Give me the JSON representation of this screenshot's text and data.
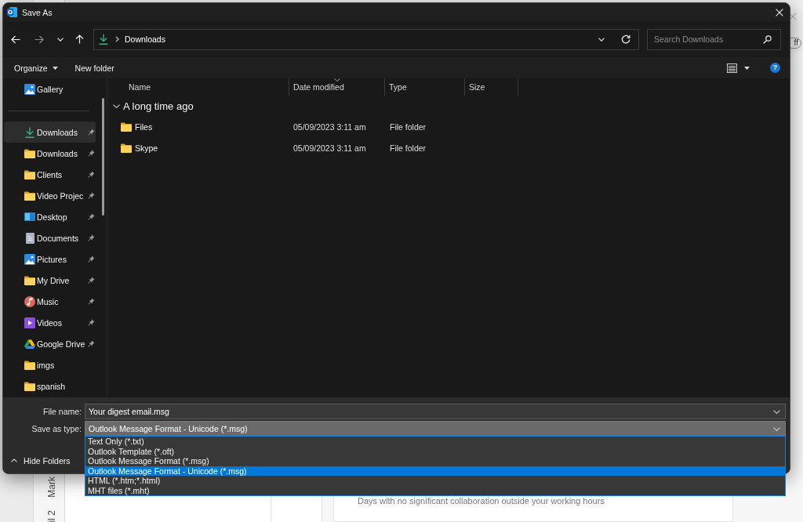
{
  "window": {
    "title": "Save As"
  },
  "navigation": {
    "buttons": [
      {
        "kind": "back",
        "disabled": false
      },
      {
        "kind": "forward",
        "disabled": true
      },
      {
        "kind": "recent",
        "disabled": false
      },
      {
        "kind": "up",
        "disabled": false
      }
    ],
    "address": {
      "path": [
        "Downloads"
      ]
    },
    "search": {
      "placeholder": "Search Downloads"
    }
  },
  "toolbar": {
    "organize": "Organize",
    "new_folder": "New folder",
    "help": "?"
  },
  "sidebar": {
    "sections": [
      {
        "items": [
          {
            "label": "Gallery",
            "kind": "gallery",
            "pinned": false,
            "selected": false
          }
        ]
      },
      {
        "items": [
          {
            "label": "Downloads",
            "kind": "downloads",
            "pinned": true,
            "selected": true
          },
          {
            "label": "Downloads",
            "kind": "folder",
            "pinned": true,
            "selected": false
          },
          {
            "label": "Clients",
            "kind": "folder",
            "pinned": true,
            "selected": false
          },
          {
            "label": "Video Projec",
            "kind": "folder",
            "pinned": true,
            "selected": false
          },
          {
            "label": "Desktop",
            "kind": "desktop",
            "pinned": true,
            "selected": false
          },
          {
            "label": "Documents",
            "kind": "documents",
            "pinned": true,
            "selected": false
          },
          {
            "label": "Pictures",
            "kind": "pictures",
            "pinned": true,
            "selected": false
          },
          {
            "label": "My Drive",
            "kind": "folder",
            "pinned": true,
            "selected": false
          },
          {
            "label": "Music",
            "kind": "music",
            "pinned": true,
            "selected": false
          },
          {
            "label": "Videos",
            "kind": "videos",
            "pinned": true,
            "selected": false
          },
          {
            "label": "Google Drive",
            "kind": "drive",
            "pinned": true,
            "selected": false
          },
          {
            "label": "imgs",
            "kind": "folder",
            "pinned": false,
            "selected": false
          },
          {
            "label": "spanish",
            "kind": "folder",
            "pinned": false,
            "selected": false
          }
        ]
      }
    ]
  },
  "file_list": {
    "columns": [
      {
        "label": "Name",
        "sorted": false
      },
      {
        "label": "Date modified",
        "sorted": true
      },
      {
        "label": "Type",
        "sorted": false
      },
      {
        "label": "Size",
        "sorted": false
      }
    ],
    "groups": [
      {
        "label": "A long time ago",
        "expanded": true,
        "rows": [
          {
            "name": "Files",
            "date_modified": "05/09/2023 3:11 am",
            "type": "File folder"
          },
          {
            "name": "Skype",
            "date_modified": "05/09/2023 3:11 am",
            "type": "File folder"
          }
        ]
      }
    ]
  },
  "footer": {
    "fields": [
      {
        "label": "File name:",
        "value": "Your digest email.msg",
        "expanded": false
      },
      {
        "label": "Save as type:",
        "value": "Outlook Message Format - Unicode (*.msg)",
        "expanded": true,
        "options": [
          {
            "label": "Text Only (*.txt)",
            "selected": false
          },
          {
            "label": "Outlook Template (*.oft)",
            "selected": false
          },
          {
            "label": "Outlook Message Format (*.msg)",
            "selected": false
          },
          {
            "label": "Outlook Message Format - Unicode (*.msg)",
            "selected": true
          },
          {
            "label": "HTML (*.htm;*.html)",
            "selected": false
          },
          {
            "label": "MHT files (*.mht)",
            "selected": false
          }
        ]
      }
    ],
    "hide_folders": "Hide Folders"
  },
  "background": {
    "toggle": "ff",
    "rail_labels": [
      "Mark",
      "il 2"
    ],
    "notice": "Days with no significant collaboration outside your working hours"
  }
}
